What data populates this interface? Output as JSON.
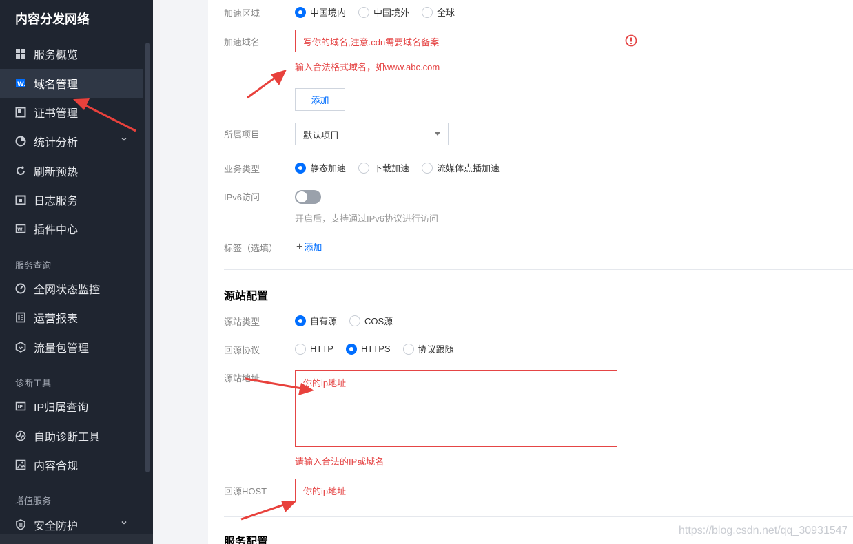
{
  "sidebar": {
    "brand": "内容分发网络",
    "items": [
      {
        "label": "服务概览",
        "icon": "grid-icon"
      },
      {
        "label": "域名管理",
        "icon": "domain-icon"
      },
      {
        "label": "证书管理",
        "icon": "certificate-icon"
      },
      {
        "label": "统计分析",
        "icon": "pie-chart-icon"
      },
      {
        "label": "刷新预热",
        "icon": "refresh-icon"
      },
      {
        "label": "日志服务",
        "icon": "log-icon"
      },
      {
        "label": "插件中心",
        "icon": "plugin-icon"
      }
    ],
    "section_query": "服务查询",
    "query_items": [
      {
        "label": "全网状态监控",
        "icon": "monitor-icon"
      },
      {
        "label": "运营报表",
        "icon": "report-icon"
      },
      {
        "label": "流量包管理",
        "icon": "package-icon"
      }
    ],
    "section_diag": "诊断工具",
    "diag_items": [
      {
        "label": "IP归属查询",
        "icon": "ip-icon"
      },
      {
        "label": "自助诊断工具",
        "icon": "pulse-icon"
      },
      {
        "label": "内容合规",
        "icon": "image-icon"
      }
    ],
    "section_value": "增值服务",
    "value_items": [
      {
        "label": "安全防护",
        "icon": "shield-icon"
      }
    ]
  },
  "form": {
    "region": {
      "label": "加速区域",
      "options": [
        "中国境内",
        "中国境外",
        "全球"
      ],
      "selected": 0
    },
    "domain": {
      "label": "加速域名",
      "value": "写你的域名,注意.cdn需要域名备案",
      "error": "输入合法格式域名，如www.abc.com",
      "error_icon": "exclamation-circle-icon"
    },
    "add_button": "添加",
    "project": {
      "label": "所属项目",
      "value": "默认项目"
    },
    "business": {
      "label": "业务类型",
      "options": [
        "静态加速",
        "下载加速",
        "流媒体点播加速"
      ],
      "selected": 0
    },
    "ipv6": {
      "label": "IPv6访问",
      "hint": "开启后，支持通过IPv6协议进行访问"
    },
    "tags": {
      "label": "标签（选填）",
      "add": "添加"
    }
  },
  "origin": {
    "title": "源站配置",
    "type": {
      "label": "源站类型",
      "options": [
        "自有源",
        "COS源"
      ],
      "selected": 0
    },
    "protocol": {
      "label": "回源协议",
      "options": [
        "HTTP",
        "HTTPS",
        "协议跟随"
      ],
      "selected": 1
    },
    "address": {
      "label": "源站地址",
      "value": "你的ip地址",
      "error": "请输入合法的IP或域名"
    },
    "host": {
      "label": "回源HOST",
      "value": "你的ip地址"
    }
  },
  "service": {
    "title": "服务配置"
  },
  "watermark": "https://blog.csdn.net/qq_30931547",
  "colors": {
    "accent": "#006eff",
    "error": "#e54545",
    "annotation_arrow": "#e8413c",
    "sidebar_bg": "#1f2530"
  }
}
